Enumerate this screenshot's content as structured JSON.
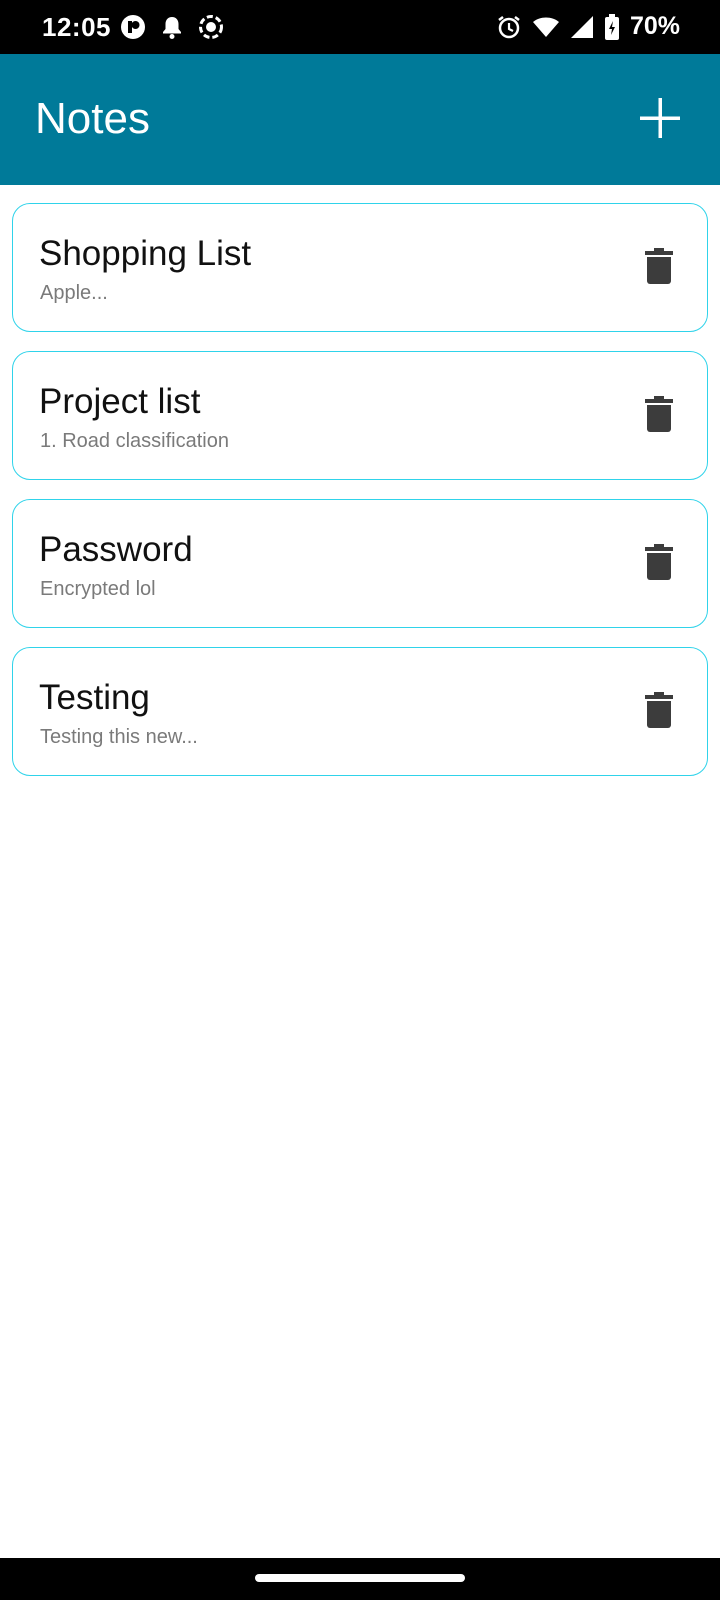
{
  "status_bar": {
    "time": "12:05",
    "battery": "70%",
    "left_icons": [
      "app-notification-icon",
      "bell-icon",
      "screen-record-icon"
    ],
    "right_icons": [
      "alarm-icon",
      "wifi-icon",
      "cellular-signal-icon",
      "battery-charging-icon"
    ]
  },
  "app_bar": {
    "title": "Notes",
    "add_icon": "plus-icon",
    "background_color": "#007a99"
  },
  "notes": [
    {
      "title": "Shopping List",
      "preview": "Apple..."
    },
    {
      "title": "Project list",
      "preview": "1. Road classification"
    },
    {
      "title": "Password",
      "preview": "Encrypted lol"
    },
    {
      "title": "Testing",
      "preview": "Testing this new..."
    }
  ],
  "colors": {
    "card_border": "#2fd3ea",
    "delete_icon": "#3c3c3c"
  }
}
